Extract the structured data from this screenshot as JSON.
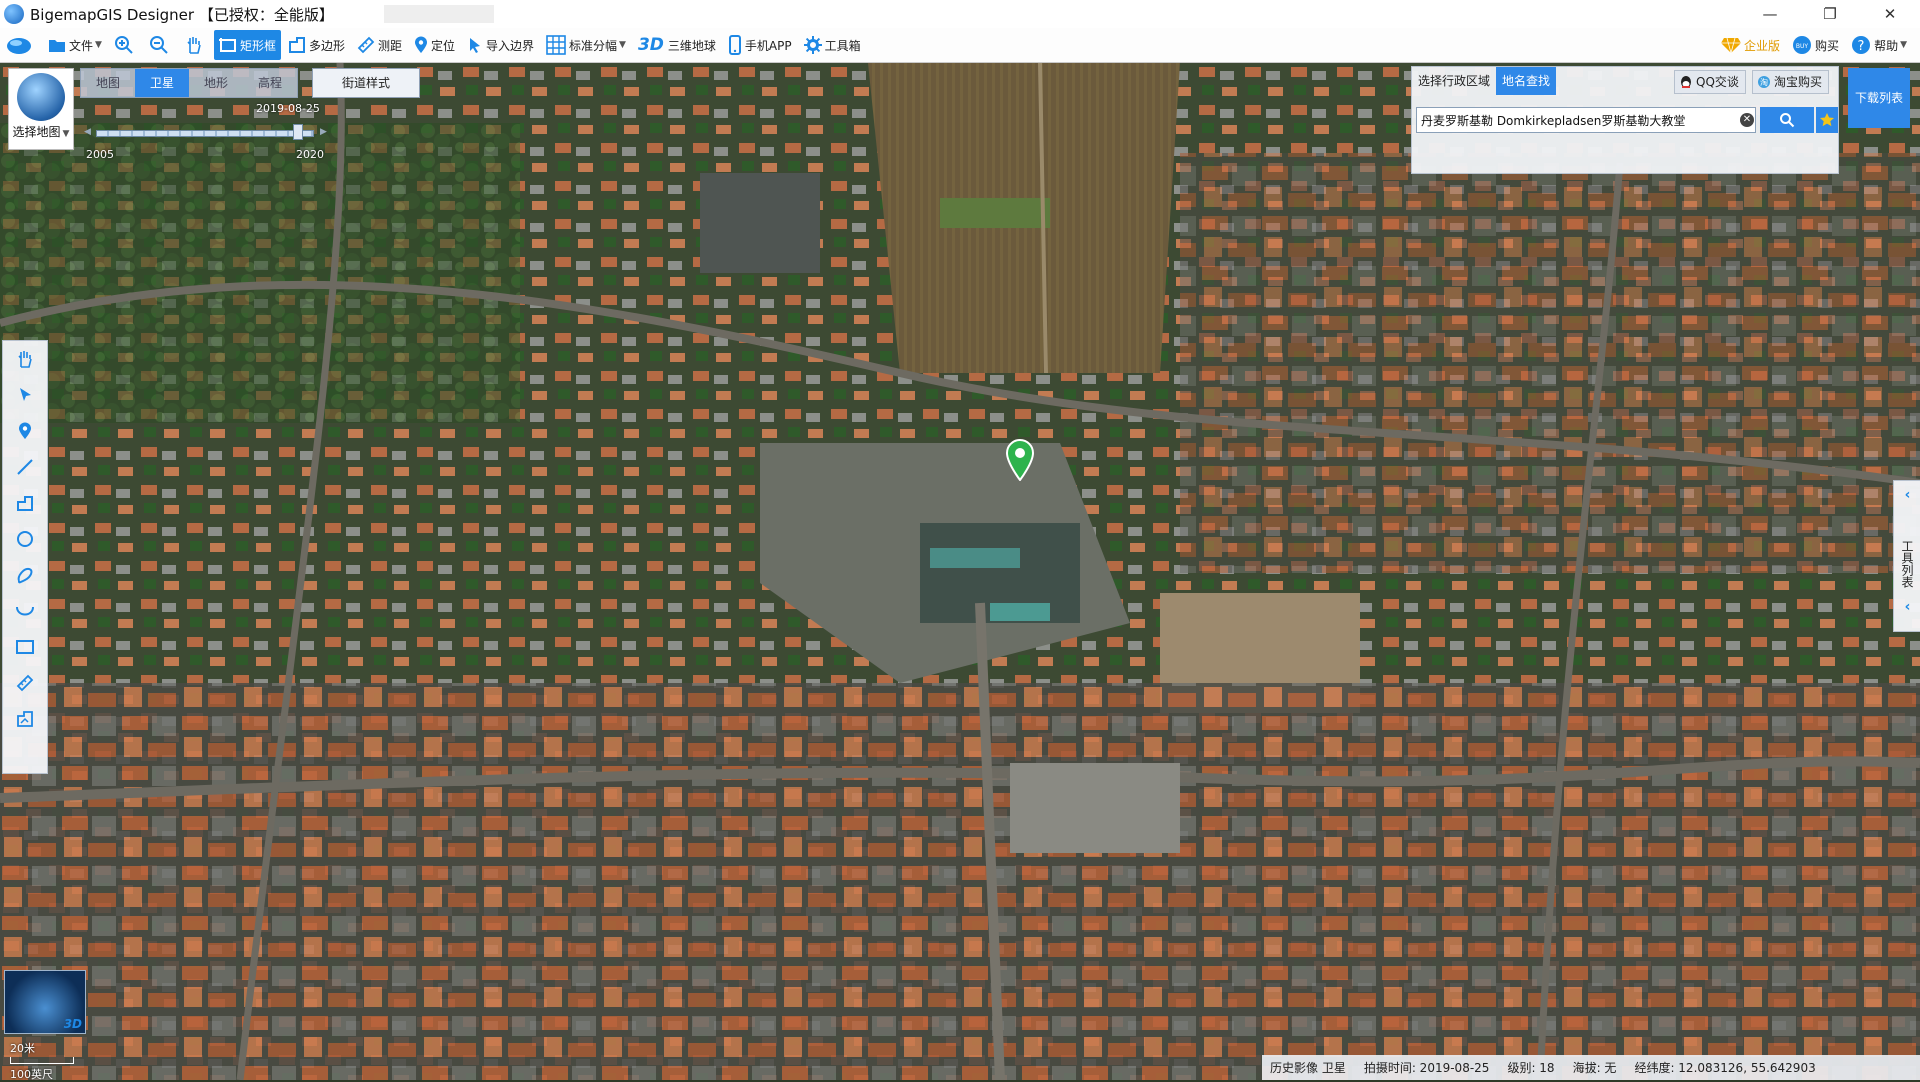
{
  "window": {
    "title": "BigemapGIS Designer 【已授权：全能版】",
    "controls": [
      "—",
      "❐",
      "✕"
    ]
  },
  "toolbar": {
    "file": "文件",
    "rect": "矩形框",
    "polygon": "多边形",
    "measure": "测距",
    "locate": "定位",
    "import_boundary": "导入边界",
    "standard_sheet": "标准分幅",
    "threed_badge": "3D",
    "globe": "三维地球",
    "mobile_app": "手机APP",
    "toolbox": "工具箱",
    "enterprise": "企业版",
    "buy": "购买",
    "help": "帮助",
    "accent_color": "#1e88e5"
  },
  "map_panel": {
    "select_map": "选择地图",
    "tabs": [
      "地图",
      "卫星",
      "地形",
      "高程"
    ],
    "active_tab": "卫星",
    "street_style": "街道样式",
    "current_date": "2019-08-25",
    "year_min": "2005",
    "year_max": "2020",
    "timeline_position": 0.93
  },
  "search": {
    "tab_region": "选择行政区域",
    "tab_place": "地名查找",
    "qq": "QQ交谈",
    "taobao": "淘宝购买",
    "query": "丹麦罗斯基勒 Domkirkepladsen罗斯基勒大教堂",
    "clear_icon": "clear-icon",
    "search_icon": "search-icon",
    "favorite_icon": "star-icon"
  },
  "download_list": "下载列表",
  "left_tools": [
    "hand-icon",
    "pointer-icon",
    "marker-icon",
    "line-icon",
    "polyline-icon",
    "circle-icon",
    "freehand-icon",
    "curve-icon",
    "rectangle-icon",
    "ruler-icon",
    "area-measure-icon"
  ],
  "right_handle": {
    "label": "工具列表"
  },
  "minimap": {
    "badge": "3D"
  },
  "scale": {
    "metric": "20米",
    "imperial": "100英尺"
  },
  "status": {
    "source": "历史影像 卫星",
    "capture_time": "拍摄时间: 2019-08-25",
    "level": "级别:  18",
    "altitude": "海拔: 无",
    "coords": "经纬度:  12.083126, 55.642903"
  }
}
